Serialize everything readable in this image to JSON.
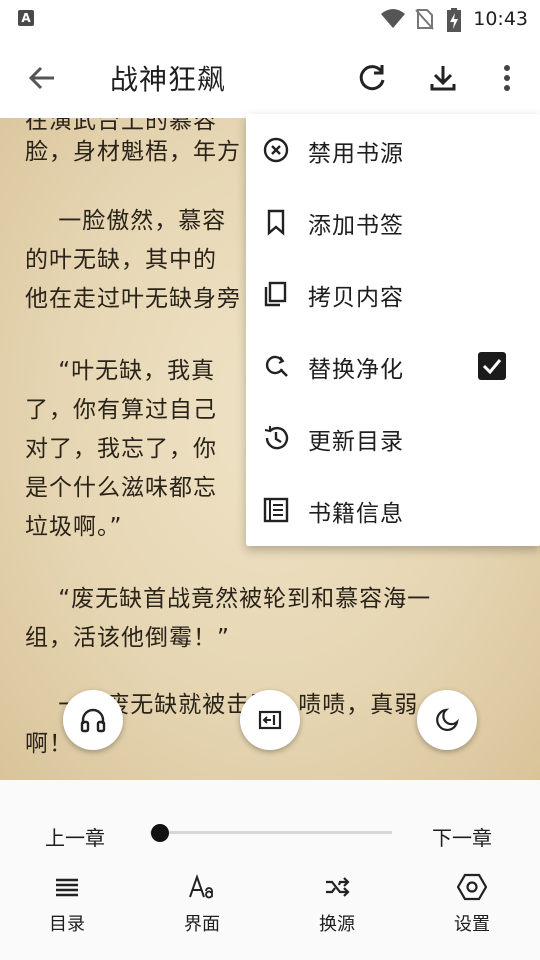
{
  "status_bar": {
    "notification_icon_letter": "A",
    "time": "10:43",
    "icons": [
      "wifi-icon",
      "no-sim-icon",
      "battery-charging-icon"
    ]
  },
  "app_bar": {
    "title": "战神狂飙",
    "icons": [
      "back-arrow-icon",
      "refresh-icon",
      "download-icon",
      "more-vert-icon"
    ]
  },
  "reader": {
    "paragraphs": [
      "在演武台上的慕容",
      "脸，身材魁梧，年方",
      "    一脸傲然，慕容\n的叶无缺，其中的\n他在走过叶无缺身旁",
      "    “叶无缺，我真\n了，你有算过自己\n对了，我忘了，你\n是个什么滋味都忘\n垃圾啊。”",
      "    “废无缺首战竟然被轮到和慕容海一\n组，活该他倒霉！”",
      "    一招废无缺就被击败，啧啧，真弱\n啊！"
    ]
  },
  "menu": {
    "items": [
      {
        "label": "禁用书源",
        "icon": "block-circle-icon"
      },
      {
        "label": "添加书签",
        "icon": "bookmark-icon"
      },
      {
        "label": "拷贝内容",
        "icon": "copy-icon"
      },
      {
        "label": "替换净化",
        "icon": "find-replace-icon",
        "checked": true
      },
      {
        "label": "更新目录",
        "icon": "history-icon"
      },
      {
        "label": "书籍信息",
        "icon": "book-info-icon"
      }
    ]
  },
  "floating_buttons": [
    "headphones-icon",
    "exit-text-icon",
    "night-mode-icon"
  ],
  "bottom_panel": {
    "prev_chapter": "上一章",
    "next_chapter": "下一章",
    "progress": 0.0,
    "tools": [
      {
        "label": "目录",
        "icon": "list-icon"
      },
      {
        "label": "界面",
        "icon": "font-size-icon"
      },
      {
        "label": "换源",
        "icon": "shuffle-icon"
      },
      {
        "label": "设置",
        "icon": "settings-hexagon-icon"
      }
    ]
  },
  "colors": {
    "page_background": "#e9dcc1",
    "text": "#2a2319",
    "menu_background": "#ffffff",
    "accent_dark": "#111111"
  }
}
